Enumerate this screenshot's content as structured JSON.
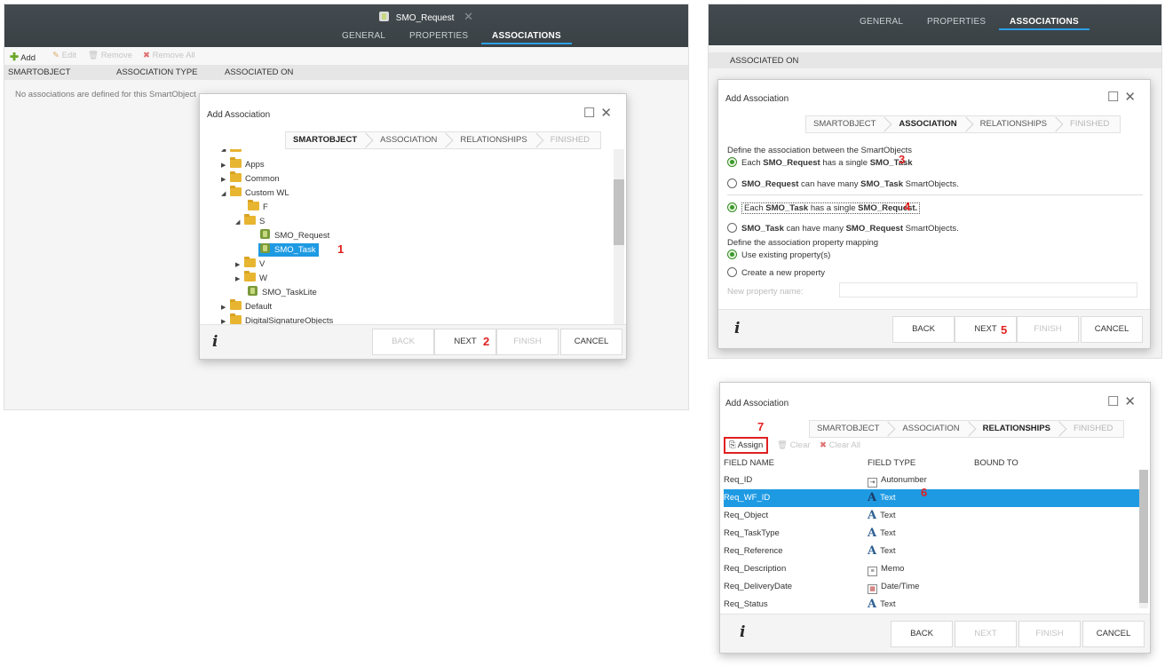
{
  "window": {
    "title": "SMO_Request",
    "tabs": [
      "GENERAL",
      "PROPERTIES",
      "ASSOCIATIONS"
    ]
  },
  "left": {
    "toolbar": {
      "add": "Add",
      "edit": "Edit",
      "remove": "Remove",
      "remove_all": "Remove All"
    },
    "columns": [
      "SMARTOBJECT",
      "ASSOCIATION TYPE",
      "ASSOCIATED ON"
    ],
    "empty_message": "No associations are defined for this SmartObject"
  },
  "dialog": {
    "title": "Add Association",
    "steps": [
      "SMARTOBJECT",
      "ASSOCIATION",
      "RELATIONSHIPS",
      "FINISHED"
    ],
    "buttons": {
      "back": "BACK",
      "next": "NEXT",
      "finish": "FINISH",
      "cancel": "CANCEL"
    }
  },
  "tree": {
    "items": [
      "Apps",
      "Common",
      "Custom WL",
      "F",
      "S",
      "SMO_Request",
      "SMO_Task",
      "V",
      "W",
      "SMO_TaskLite",
      "Default",
      "DigitalSignatureObjects"
    ]
  },
  "step2": {
    "partial_col": "ASSOCIATED ON",
    "define_label": "Define the association between the SmartObjects",
    "opt1_pre": "Each",
    "opt1_a": "SMO_Request",
    "opt1_mid": "has a single",
    "opt1_b": "SMO_Task",
    "opt2_a": "SMO_Request",
    "opt2_mid": "can have many",
    "opt2_b": "SMO_Task",
    "opt2_post": "SmartObjects.",
    "opt3_pre": "Each",
    "opt3_a": "SMO_Task",
    "opt3_mid": "has a single",
    "opt3_b": "SMO_Request.",
    "opt4_a": "SMO_Task",
    "opt4_mid": "can have many",
    "opt4_b": "SMO_Request",
    "opt4_post": "SmartObjects.",
    "mapping_label": "Define the association property mapping",
    "use_existing": "Use existing property(s)",
    "create_new": "Create a new property",
    "new_prop_label": "New property name:"
  },
  "step3": {
    "toolbar": {
      "assign": "Assign",
      "clear": "Clear",
      "clear_all": "Clear All"
    },
    "columns": [
      "FIELD NAME",
      "FIELD TYPE",
      "BOUND TO"
    ],
    "rows": [
      {
        "name": "Req_ID",
        "type": "Autonumber"
      },
      {
        "name": "Req_WF_ID",
        "type": "Text"
      },
      {
        "name": "Req_Object",
        "type": "Text"
      },
      {
        "name": "Req_TaskType",
        "type": "Text"
      },
      {
        "name": "Req_Reference",
        "type": "Text"
      },
      {
        "name": "Req_Description",
        "type": "Memo"
      },
      {
        "name": "Req_DeliveryDate",
        "type": "Date/Time"
      },
      {
        "name": "Req_Status",
        "type": "Text"
      }
    ]
  },
  "annotations": {
    "n1": "1",
    "n2": "2",
    "n3": "3",
    "n4": "4",
    "n5": "5",
    "n6": "6",
    "n7": "7"
  }
}
